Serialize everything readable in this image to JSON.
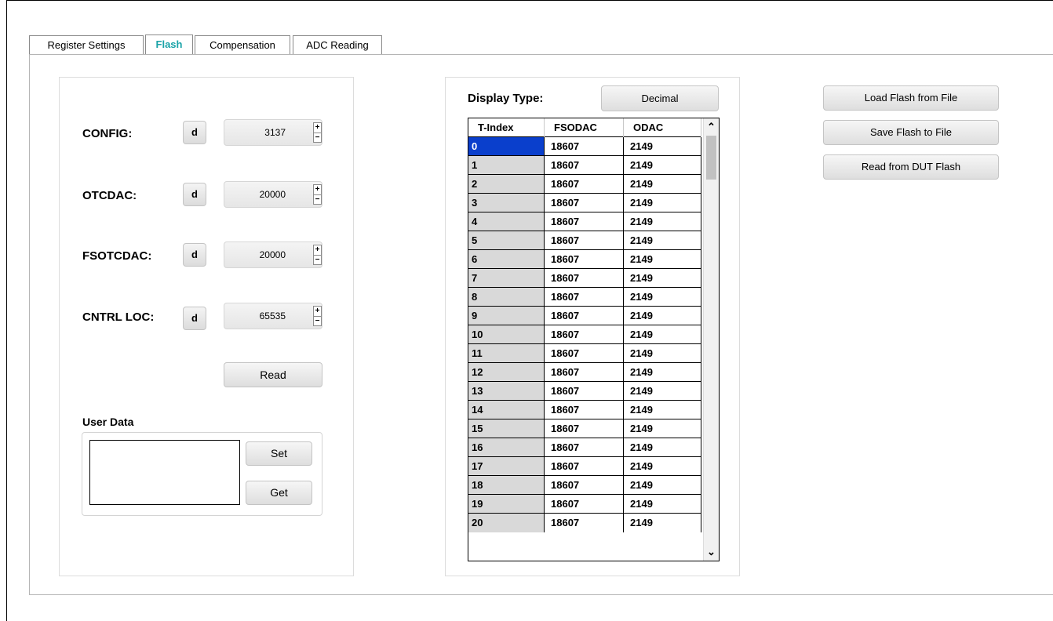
{
  "tabs": [
    {
      "label": "Register Settings"
    },
    {
      "label": "Flash"
    },
    {
      "label": "Compensation"
    },
    {
      "label": "ADC Reading"
    }
  ],
  "registers": [
    {
      "label": "CONFIG:",
      "format": "d",
      "value": "3137"
    },
    {
      "label": "OTCDAC:",
      "format": "d",
      "value": "20000"
    },
    {
      "label": "FSOTCDAC:",
      "format": "d",
      "value": "20000"
    },
    {
      "label": "CNTRL LOC:",
      "format": "d",
      "value": "65535"
    }
  ],
  "spin_up": "+",
  "spin_down": "−",
  "read_button": "Read",
  "user_data": {
    "title": "User Data",
    "value": "",
    "set_label": "Set",
    "get_label": "Get"
  },
  "display": {
    "label": "Display Type:",
    "value": "Decimal"
  },
  "grid": {
    "columns": [
      "T-Index",
      "FSODAC",
      "ODAC"
    ],
    "rows": [
      [
        "0",
        "18607",
        "2149"
      ],
      [
        "1",
        "18607",
        "2149"
      ],
      [
        "2",
        "18607",
        "2149"
      ],
      [
        "3",
        "18607",
        "2149"
      ],
      [
        "4",
        "18607",
        "2149"
      ],
      [
        "5",
        "18607",
        "2149"
      ],
      [
        "6",
        "18607",
        "2149"
      ],
      [
        "7",
        "18607",
        "2149"
      ],
      [
        "8",
        "18607",
        "2149"
      ],
      [
        "9",
        "18607",
        "2149"
      ],
      [
        "10",
        "18607",
        "2149"
      ],
      [
        "11",
        "18607",
        "2149"
      ],
      [
        "12",
        "18607",
        "2149"
      ],
      [
        "13",
        "18607",
        "2149"
      ],
      [
        "14",
        "18607",
        "2149"
      ],
      [
        "15",
        "18607",
        "2149"
      ],
      [
        "16",
        "18607",
        "2149"
      ],
      [
        "17",
        "18607",
        "2149"
      ],
      [
        "18",
        "18607",
        "2149"
      ],
      [
        "19",
        "18607",
        "2149"
      ],
      [
        "20",
        "18607",
        "2149"
      ]
    ],
    "selected_index": "0"
  },
  "scroll_up": "⌃",
  "scroll_down": "⌄",
  "actions": {
    "load": "Load Flash from File",
    "save": "Save Flash to File",
    "read_dut": "Read from DUT Flash"
  }
}
